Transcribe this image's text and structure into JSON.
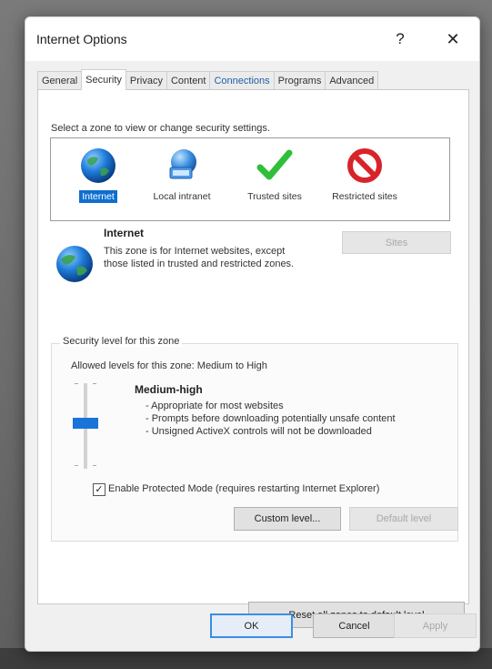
{
  "window": {
    "title": "Internet Options",
    "help_glyph": "?",
    "close_glyph": "✕"
  },
  "tabs": [
    {
      "label": "General"
    },
    {
      "label": "Security"
    },
    {
      "label": "Privacy"
    },
    {
      "label": "Content"
    },
    {
      "label": "Connections"
    },
    {
      "label": "Programs"
    },
    {
      "label": "Advanced"
    }
  ],
  "security": {
    "zone_caption": "Select a zone to view or change security settings.",
    "zones": [
      {
        "label": "Internet",
        "icon": "globe-icon",
        "selected": true
      },
      {
        "label": "Local intranet",
        "icon": "intranet-globe-icon",
        "selected": false
      },
      {
        "label": "Trusted sites",
        "icon": "checkmark-icon",
        "selected": false
      },
      {
        "label": "Restricted sites",
        "icon": "no-entry-icon",
        "selected": false
      }
    ],
    "info_title": "Internet",
    "info_desc": "This zone is for Internet websites, except those listed in trusted and restricted zones.",
    "sites_label": "Sites",
    "level_group_title": "Security level for this zone",
    "allowed_levels": "Allowed levels for this zone: Medium to High",
    "level_name": "Medium-high",
    "level_points": [
      "- Appropriate for most websites",
      "- Prompts before downloading potentially unsafe content",
      "- Unsigned ActiveX controls will not be downloaded"
    ],
    "protected_mode_label": "Enable Protected Mode (requires restarting Internet Explorer)",
    "protected_mode_checked": true,
    "custom_level_label": "Custom level...",
    "default_level_label": "Default level",
    "reset_label": "Reset all zones to default level"
  },
  "footer": {
    "ok_label": "OK",
    "cancel_label": "Cancel",
    "apply_label": "Apply"
  },
  "colors": {
    "selection_blue": "#0f6fd0",
    "slider_thumb": "#1a73d9"
  }
}
